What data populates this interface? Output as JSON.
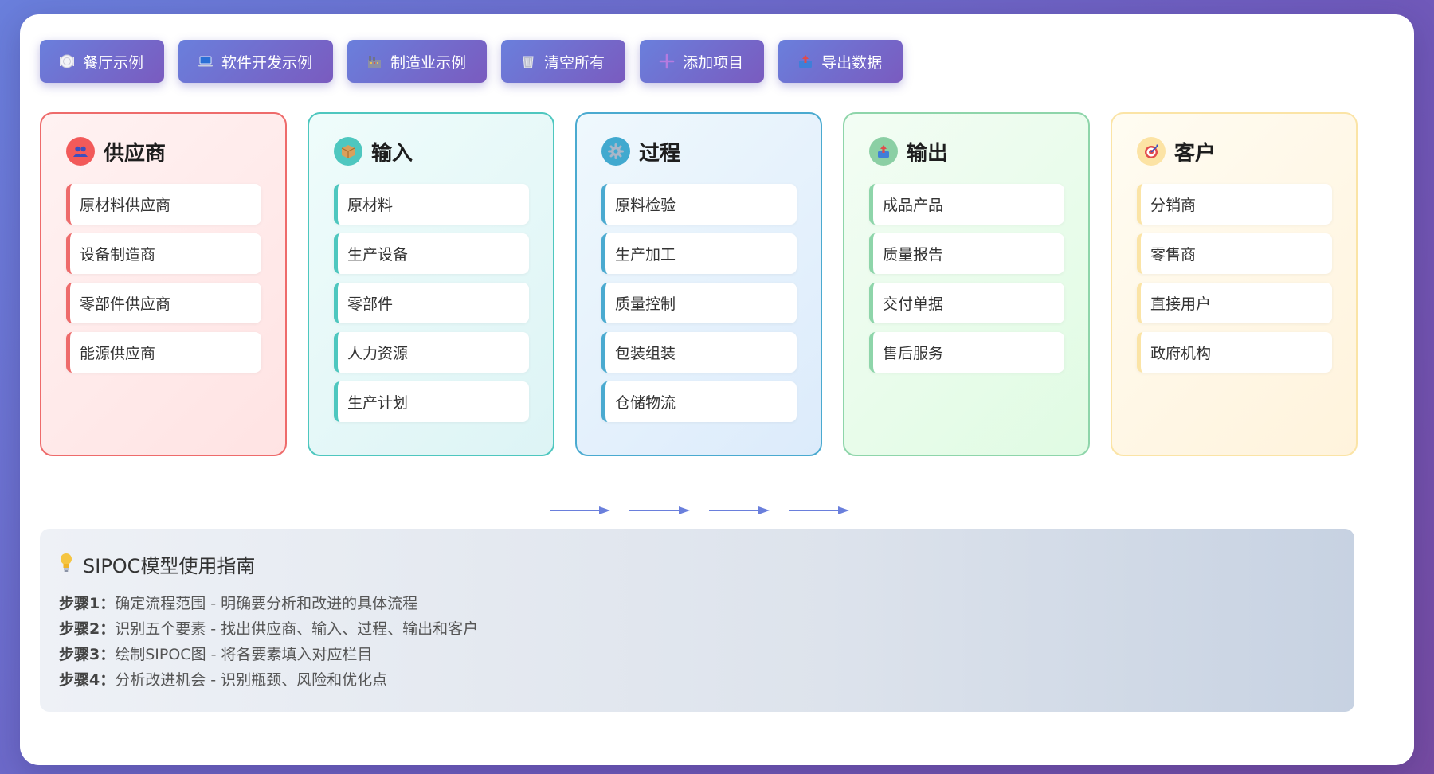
{
  "toolbar": {
    "buttons": [
      {
        "label": "餐厅示例",
        "icon": "plate-icon"
      },
      {
        "label": "软件开发示例",
        "icon": "laptop-icon"
      },
      {
        "label": "制造业示例",
        "icon": "factory-icon"
      },
      {
        "label": "清空所有",
        "icon": "trash-icon"
      },
      {
        "label": "添加项目",
        "icon": "plus-icon"
      },
      {
        "label": "导出数据",
        "icon": "export-icon"
      }
    ]
  },
  "columns": [
    {
      "title": "供应商",
      "icon": "people-icon",
      "accent": "#ee6b6b",
      "items": [
        "原材料供应商",
        "设备制造商",
        "零部件供应商",
        "能源供应商"
      ]
    },
    {
      "title": "输入",
      "icon": "box-icon",
      "accent": "#4ec7bf",
      "items": [
        "原材料",
        "生产设备",
        "零部件",
        "人力资源",
        "生产计划"
      ]
    },
    {
      "title": "过程",
      "icon": "gear-icon",
      "accent": "#4aaad0",
      "items": [
        "原料检验",
        "生产加工",
        "质量控制",
        "包装组装",
        "仓储物流"
      ]
    },
    {
      "title": "输出",
      "icon": "outbox-icon",
      "accent": "#8ed5aa",
      "items": [
        "成品产品",
        "质量报告",
        "交付单据",
        "售后服务"
      ]
    },
    {
      "title": "客户",
      "icon": "target-icon",
      "accent": "#fbe4a6",
      "items": [
        "分销商",
        "零售商",
        "直接用户",
        "政府机构"
      ]
    }
  ],
  "flow_arrow_color": "#6a7fdc",
  "guide": {
    "icon": "lightbulb-icon",
    "title": "SIPOC模型使用指南",
    "steps": [
      {
        "label": "步骤1：",
        "text": "确定流程范围 - 明确要分析和改进的具体流程"
      },
      {
        "label": "步骤2：",
        "text": "识别五个要素 - 找出供应商、输入、过程、输出和客户"
      },
      {
        "label": "步骤3：",
        "text": "绘制SIPOC图 - 将各要素填入对应栏目"
      },
      {
        "label": "步骤4：",
        "text": "分析改进机会 - 识别瓶颈、风险和优化点"
      }
    ]
  }
}
